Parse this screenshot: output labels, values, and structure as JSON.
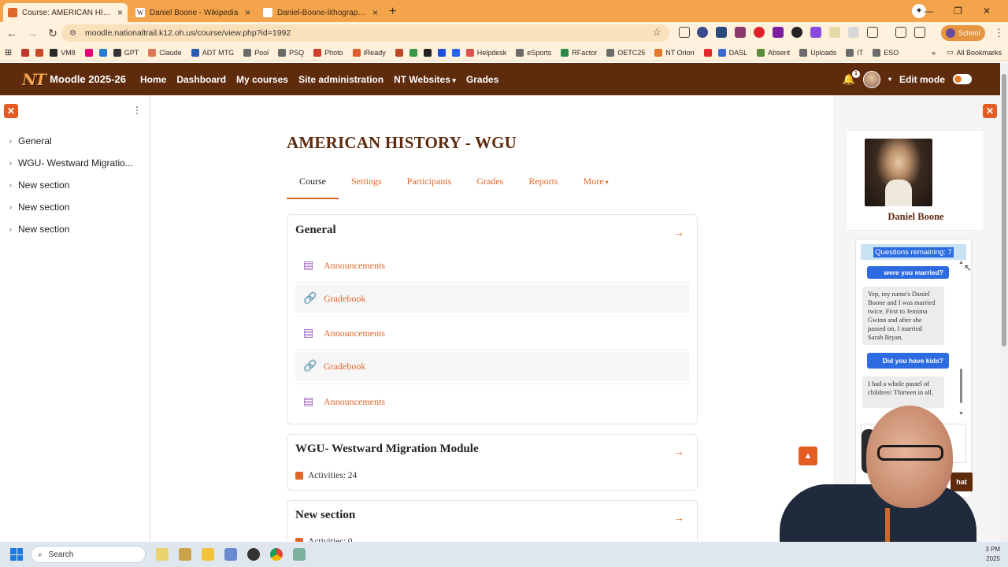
{
  "browser": {
    "tabs": [
      {
        "title": "Course: AMERICAN HISTORY - WGU",
        "favicon_color": "#e0672a",
        "active": true
      },
      {
        "title": "Daniel Boone - Wikipedia",
        "favicon_color": "#ffffff"
      },
      {
        "title": "Daniel-Boone-lithograph-paint...",
        "favicon_color": "#ffffff"
      }
    ],
    "new_tab": "+",
    "url": "moodle.nationaltrail.k12.oh.us/course/view.php?id=1992",
    "profile_label": "School",
    "bookmarks": [
      {
        "label": "",
        "color": "#c2372a"
      },
      {
        "label": "",
        "color": "#c84a2a"
      },
      {
        "label": "VM8",
        "color": "#2a2a2a"
      },
      {
        "label": "",
        "color": "#e20074"
      },
      {
        "label": "",
        "color": "#2a7ad0"
      },
      {
        "label": "GPT",
        "color": "#333333"
      },
      {
        "label": "Claude",
        "color": "#d97757"
      },
      {
        "label": "ADT MTG",
        "color": "#2a5ab0"
      },
      {
        "label": "Pool",
        "color": "#6b6b6b"
      },
      {
        "label": "PSQ",
        "color": "#6b6b6b"
      },
      {
        "label": "Photo",
        "color": "#d23c2a"
      },
      {
        "label": "iReady",
        "color": "#e05a2a"
      },
      {
        "label": "",
        "color": "#b84a2a"
      },
      {
        "label": "",
        "color": "#3a9a4a"
      },
      {
        "label": "",
        "color": "#222222"
      },
      {
        "label": "",
        "color": "#1d4ed8"
      },
      {
        "label": "",
        "color": "#2563eb"
      },
      {
        "label": "Helpdesk",
        "color": "#d9534f"
      },
      {
        "label": "eSports",
        "color": "#6b6b6b"
      },
      {
        "label": "RFactor",
        "color": "#2a8a4a"
      },
      {
        "label": "OETC25",
        "color": "#6b6b6b"
      },
      {
        "label": "NT Orion",
        "color": "#e07a2a"
      },
      {
        "label": "",
        "color": "#e02a2a"
      },
      {
        "label": "DASL",
        "color": "#3a6ad0"
      },
      {
        "label": "Absent",
        "color": "#5a8a3a"
      },
      {
        "label": "Uploads",
        "color": "#6b6b6b"
      },
      {
        "label": "IT",
        "color": "#6b6b6b"
      },
      {
        "label": "ESO",
        "color": "#6b6b6b"
      }
    ],
    "more_bookmarks": "»",
    "all_bookmarks": "All Bookmarks"
  },
  "header": {
    "logo": "NT",
    "site_name": "Moodle 2025-26",
    "nav": [
      "Home",
      "Dashboard",
      "My courses",
      "Site administration",
      "NT Websites",
      "Grades"
    ],
    "notification_count": "1",
    "edit_mode_label": "Edit mode",
    "edit_mode_on": false
  },
  "left_drawer": {
    "items": [
      "General",
      "WGU- Westward Migratio...",
      "New section",
      "New section",
      "New section"
    ]
  },
  "course": {
    "title": "AMERICAN HISTORY - WGU",
    "tabs": [
      "Course",
      "Settings",
      "Participants",
      "Grades",
      "Reports",
      "More"
    ],
    "active_tab": "Course",
    "sections": [
      {
        "name": "General",
        "activities": [
          {
            "name": "Announcements",
            "type": "forum"
          },
          {
            "name": "Gradebook",
            "type": "url"
          },
          {
            "name": "Announcements",
            "type": "forum"
          },
          {
            "name": "Gradebook",
            "type": "url"
          },
          {
            "name": "Announcements",
            "type": "forum"
          }
        ]
      },
      {
        "name": "WGU- Westward Migration Module",
        "activity_count": "Activities: 24"
      },
      {
        "name": "New section",
        "activity_count": "Activities: 0"
      }
    ]
  },
  "right_drawer": {
    "character_name": "Daniel Boone",
    "questions_remaining": "Questions remaining: 7",
    "messages": [
      {
        "role": "user",
        "text": "were you married?"
      },
      {
        "role": "bot",
        "text": "Yep, my name's Daniel Boone and I was married twice. First to Jemima Gwinn and after she passed on, I married Sarah Bryan."
      },
      {
        "role": "user",
        "text": "Did you have kids?"
      },
      {
        "role": "bot",
        "text": "I had a whole passel of children! Thirteen in all."
      }
    ],
    "input_placeholder": "Typ",
    "send_label": "hat"
  },
  "taskbar": {
    "search_placeholder": "Search",
    "clock_time": "3 PM",
    "clock_date": "2025"
  },
  "colors": {
    "brand": "#5e2b0d",
    "accent": "#e0672a",
    "chrome": "#f4a44a"
  }
}
